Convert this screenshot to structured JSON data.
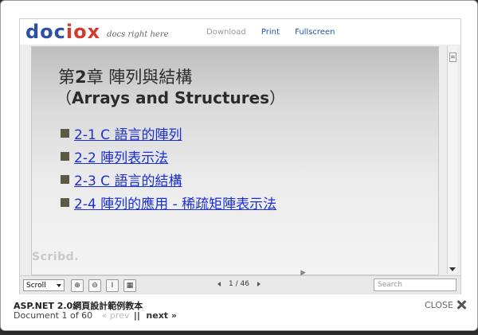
{
  "logo": {
    "brand_a": "doc",
    "brand_b": "iox",
    "tagline": "docs right here"
  },
  "toplinks": {
    "download": "Download",
    "print": "Print",
    "fullscreen": "Fullscreen"
  },
  "slide": {
    "title_prefix": "第",
    "title_num": "2",
    "title_rest": "章 陣列與結構",
    "subtitle_open": "（",
    "subtitle_text": "Arrays and Structures",
    "subtitle_close": "）",
    "bullets": [
      "2-1 C 語言的陣列",
      "2-2 陣列表示法",
      "2-3 C 語言的結構",
      "2-4 陣列的應用 - 稀疏矩陣表示法"
    ],
    "watermark": "Scribd."
  },
  "toolbar": {
    "scroll_mode": "Scroll",
    "zoom_in_icon": "zoom-in-icon",
    "zoom_out_icon": "zoom-out-icon",
    "text_select_icon": "text-select-icon",
    "grid_view_icon": "grid-view-icon",
    "page_current": "1",
    "page_total": "46",
    "page_display": "1 / 46",
    "search_placeholder": "Search"
  },
  "footer": {
    "doc_title": "ASP.NET 2.0網頁設計範例教本",
    "doc_position": "Document 1 of 60",
    "prev_label": "« prev",
    "separator": "||",
    "next_label": "next »",
    "close_label": "CLOSE"
  }
}
